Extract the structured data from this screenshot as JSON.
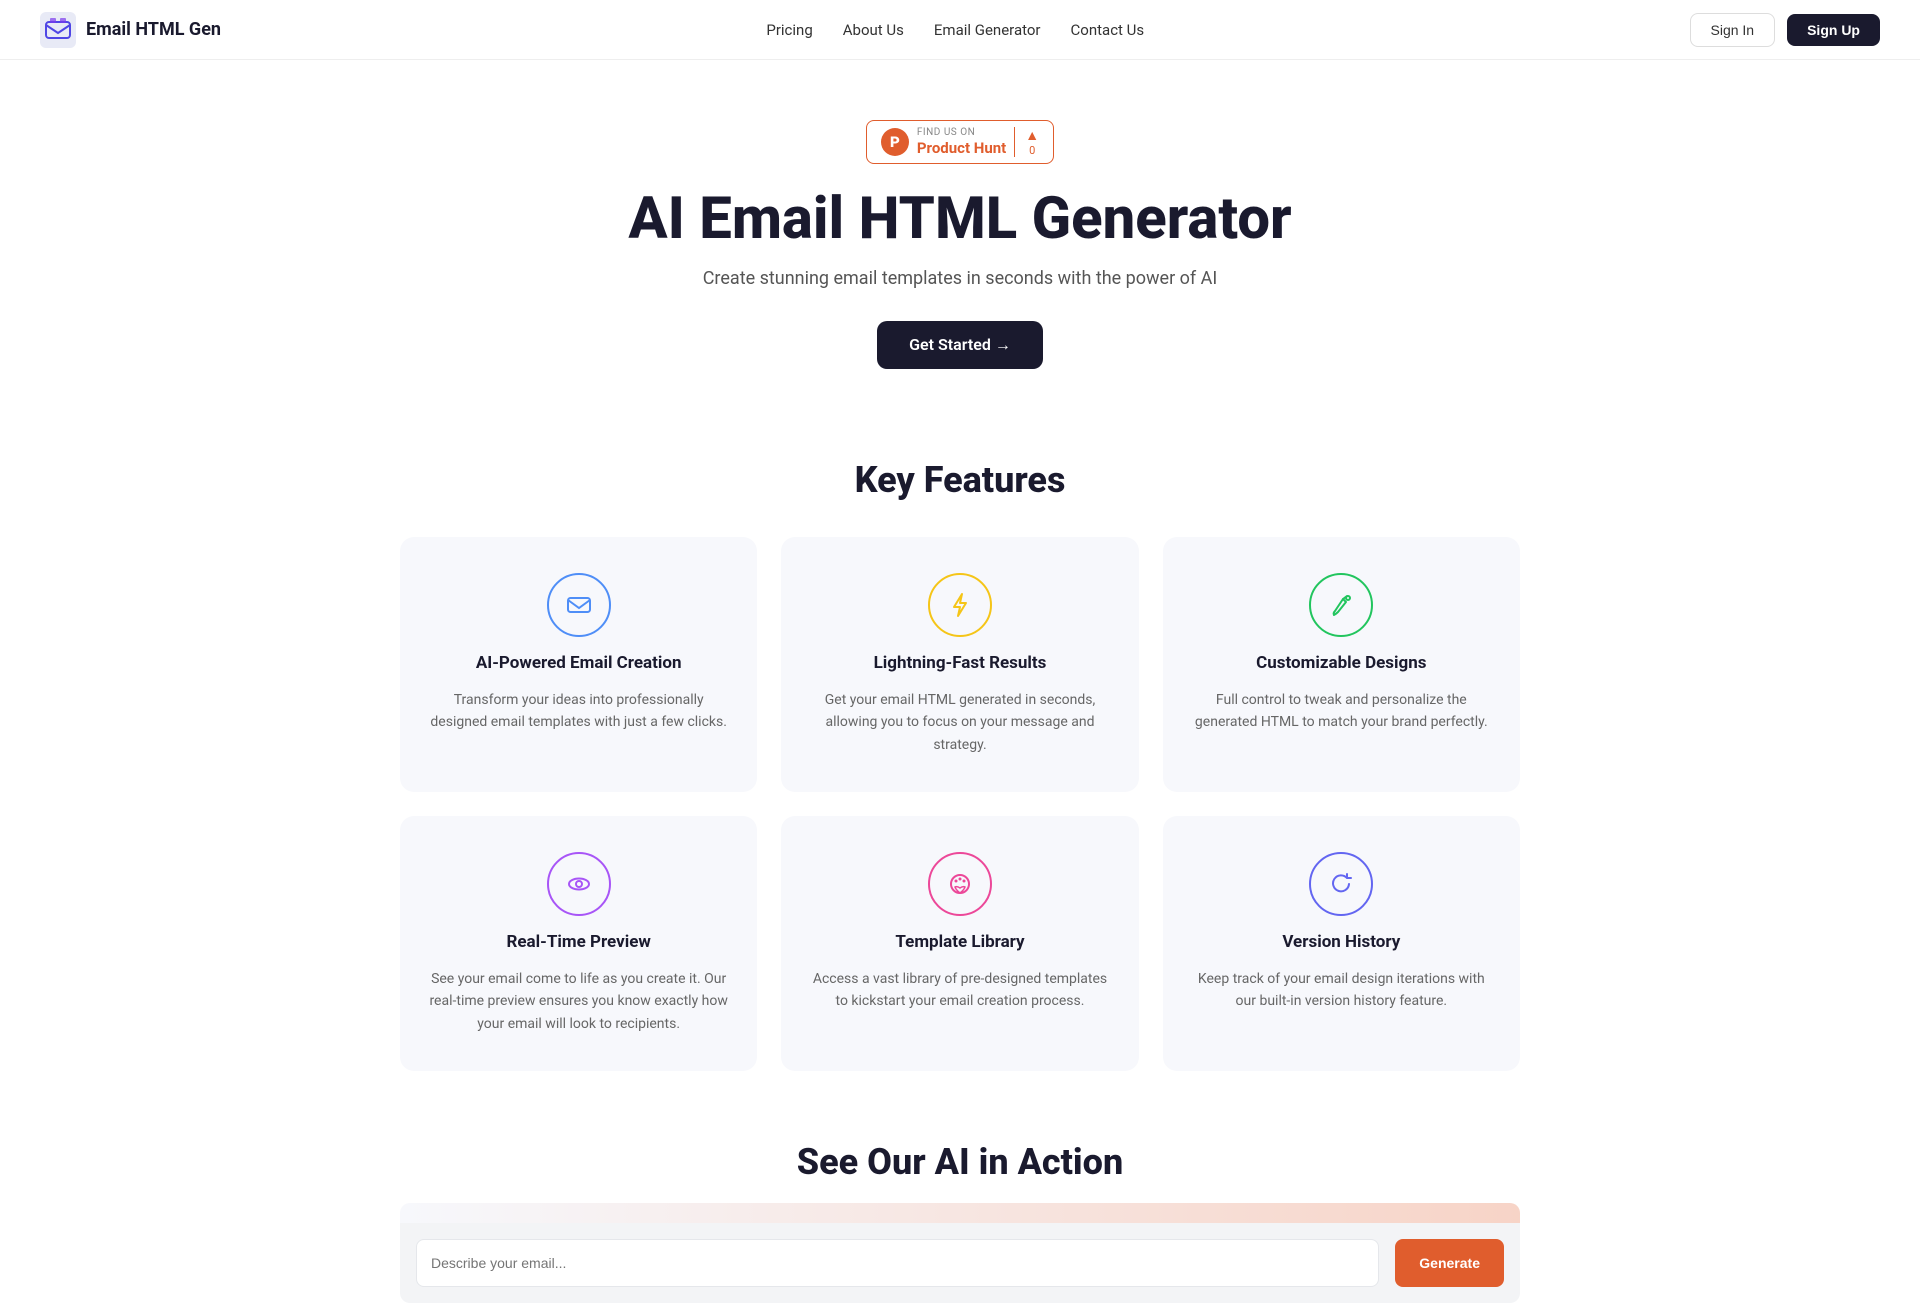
{
  "brand": {
    "name": "Email HTML Gen"
  },
  "nav": {
    "links": [
      {
        "id": "pricing",
        "label": "Pricing",
        "href": "#"
      },
      {
        "id": "about",
        "label": "About Us",
        "href": "#"
      },
      {
        "id": "email-gen",
        "label": "Email Generator",
        "href": "#"
      },
      {
        "id": "contact",
        "label": "Contact Us",
        "href": "#"
      }
    ],
    "signin_label": "Sign In",
    "signup_label": "Sign Up"
  },
  "product_hunt": {
    "find_us": "FIND US ON",
    "name": "Product Hunt",
    "upvote_count": "0"
  },
  "hero": {
    "title": "AI Email HTML Generator",
    "subtitle": "Create stunning email templates in seconds with the power of AI",
    "cta_label": "Get Started →"
  },
  "features": {
    "section_title": "Key Features",
    "items": [
      {
        "id": "ai-powered",
        "icon_name": "mail-icon",
        "icon_color": "blue",
        "title": "AI-Powered Email Creation",
        "description": "Transform your ideas into professionally designed email templates with just a few clicks."
      },
      {
        "id": "lightning-fast",
        "icon_name": "lightning-icon",
        "icon_color": "yellow",
        "title": "Lightning-Fast Results",
        "description": "Get your email HTML generated in seconds, allowing you to focus on your message and strategy."
      },
      {
        "id": "customizable",
        "icon_name": "brush-icon",
        "icon_color": "green",
        "title": "Customizable Designs",
        "description": "Full control to tweak and personalize the generated HTML to match your brand perfectly."
      },
      {
        "id": "realtime-preview",
        "icon_name": "eye-icon",
        "icon_color": "purple",
        "title": "Real-Time Preview",
        "description": "See your email come to life as you create it. Our real-time preview ensures you know exactly how your email will look to recipients."
      },
      {
        "id": "template-library",
        "icon_name": "palette-icon",
        "icon_color": "pink",
        "title": "Template Library",
        "description": "Access a vast library of pre-designed templates to kickstart your email creation process."
      },
      {
        "id": "version-history",
        "icon_name": "refresh-icon",
        "icon_color": "indigo",
        "title": "Version History",
        "description": "Keep track of your email design iterations with our built-in version history feature."
      }
    ]
  },
  "ai_demo": {
    "section_title": "See Our AI in Action",
    "input_placeholder": "Describe your email...",
    "generate_label": "Generate"
  }
}
